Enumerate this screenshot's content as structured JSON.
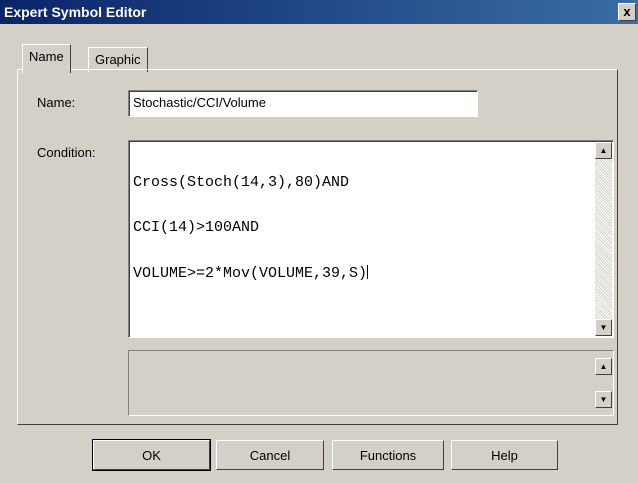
{
  "window": {
    "title": "Expert Symbol Editor",
    "close_glyph": "x"
  },
  "tabs": [
    {
      "label": "Name",
      "active": true
    },
    {
      "label": "Graphic",
      "active": false
    }
  ],
  "form": {
    "name_label": "Name:",
    "name_value": "Stochastic/CCI/Volume",
    "condition_label": "Condition:",
    "condition_lines": [
      "Cross(Stoch(14,3),80)AND",
      "CCI(14)>100AND",
      "VOLUME>=2*Mov(VOLUME,39,S)"
    ],
    "message_value": ""
  },
  "buttons": {
    "ok": "OK",
    "cancel": "Cancel",
    "functions": "Functions",
    "help": "Help"
  },
  "icons": {
    "scroll_up": "▲",
    "scroll_down": "▼"
  }
}
